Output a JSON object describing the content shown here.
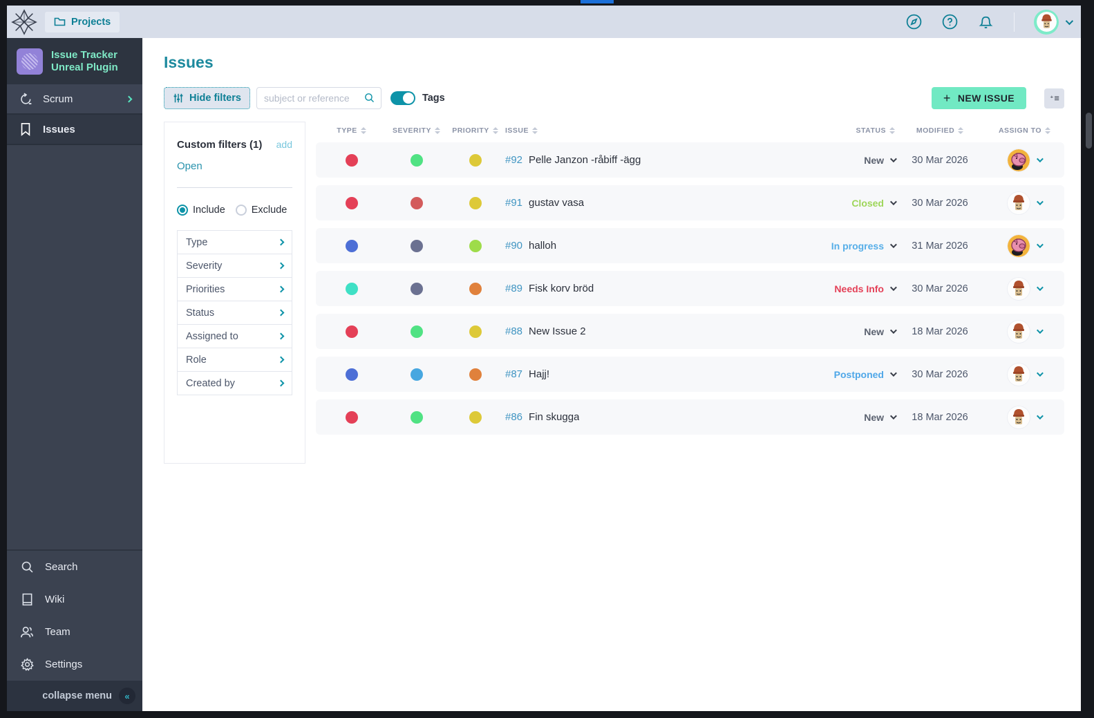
{
  "topbar": {
    "projects_label": "Projects",
    "icons": [
      "compass-icon",
      "help-icon",
      "notifications-icon"
    ]
  },
  "sidebar": {
    "project_name_line1": "Issue Tracker",
    "project_name_line2": "Unreal Plugin",
    "top_items": [
      {
        "label": "Scrum",
        "icon": "scrum-icon"
      },
      {
        "label": "Issues",
        "icon": "bookmark-icon"
      }
    ],
    "bottom_items": [
      {
        "label": "Search",
        "icon": "search-icon"
      },
      {
        "label": "Wiki",
        "icon": "book-icon"
      },
      {
        "label": "Team",
        "icon": "people-icon"
      },
      {
        "label": "Settings",
        "icon": "gear-icon"
      }
    ],
    "collapse_label": "collapse menu"
  },
  "main": {
    "title": "Issues",
    "hide_filters_label": "Hide filters",
    "search_placeholder": "subject or reference",
    "tags_label": "Tags",
    "new_issue_label": "NEW ISSUE"
  },
  "filters": {
    "title": "Custom filters (1)",
    "add_label": "add",
    "saved_filters": [
      "Open"
    ],
    "include_label": "Include",
    "exclude_label": "Exclude",
    "include_selected": true,
    "categories": [
      "Type",
      "Severity",
      "Priorities",
      "Status",
      "Assigned to",
      "Role",
      "Created by"
    ]
  },
  "table": {
    "columns": [
      "TYPE",
      "SEVERITY",
      "PRIORITY",
      "ISSUE",
      "STATUS",
      "MODIFIED",
      "ASSIGN TO"
    ],
    "status_colors": {
      "new": "#5b6270",
      "closed": "#9ed65a",
      "in_progress": "#56aee8",
      "needs_info": "#e44057",
      "postponed": "#4fa7e8"
    },
    "rows": [
      {
        "ref": "#92",
        "subject": "Pelle Janzon -råbiff -ägg",
        "type_color": "#e44057",
        "severity_color": "#50e283",
        "priority_color": "#ddc938",
        "status": "New",
        "status_color": "#5b6270",
        "modified": "30 Mar 2026",
        "avatar": "pig"
      },
      {
        "ref": "#91",
        "subject": "gustav vasa",
        "type_color": "#e44057",
        "severity_color": "#d35b5b",
        "priority_color": "#ddc938",
        "status": "Closed",
        "status_color": "#9ed65a",
        "modified": "30 Mar 2026",
        "avatar": "muffin"
      },
      {
        "ref": "#90",
        "subject": "halloh",
        "type_color": "#4d6fd6",
        "severity_color": "#6b7191",
        "priority_color": "#9edc4a",
        "status": "In progress",
        "status_color": "#56aee8",
        "modified": "31 Mar 2026",
        "avatar": "pig"
      },
      {
        "ref": "#89",
        "subject": "Fisk korv bröd",
        "type_color": "#3fe0c5",
        "severity_color": "#6b7191",
        "priority_color": "#e0813c",
        "status": "Needs Info",
        "status_color": "#e44057",
        "modified": "30 Mar 2026",
        "avatar": "muffin"
      },
      {
        "ref": "#88",
        "subject": "New Issue 2",
        "type_color": "#e44057",
        "severity_color": "#50e283",
        "priority_color": "#ddc938",
        "status": "New",
        "status_color": "#5b6270",
        "modified": "18 Mar 2026",
        "avatar": "muffin"
      },
      {
        "ref": "#87",
        "subject": "Hajj!",
        "type_color": "#4d6fd6",
        "severity_color": "#47a7e0",
        "priority_color": "#e0813c",
        "status": "Postponed",
        "status_color": "#4fa7e8",
        "modified": "30 Mar 2026",
        "avatar": "muffin"
      },
      {
        "ref": "#86",
        "subject": "Fin skugga",
        "type_color": "#e44057",
        "severity_color": "#50e283",
        "priority_color": "#ddc938",
        "status": "New",
        "status_color": "#5b6270",
        "modified": "18 Mar 2026",
        "avatar": "muffin"
      }
    ]
  },
  "colors": {
    "accent_teal": "#0e93a8",
    "mint": "#71e9c3",
    "topbar_bg": "#d7dde9",
    "sidebar_bg": "#3b4250",
    "row_bg": "#f7f8fa"
  }
}
